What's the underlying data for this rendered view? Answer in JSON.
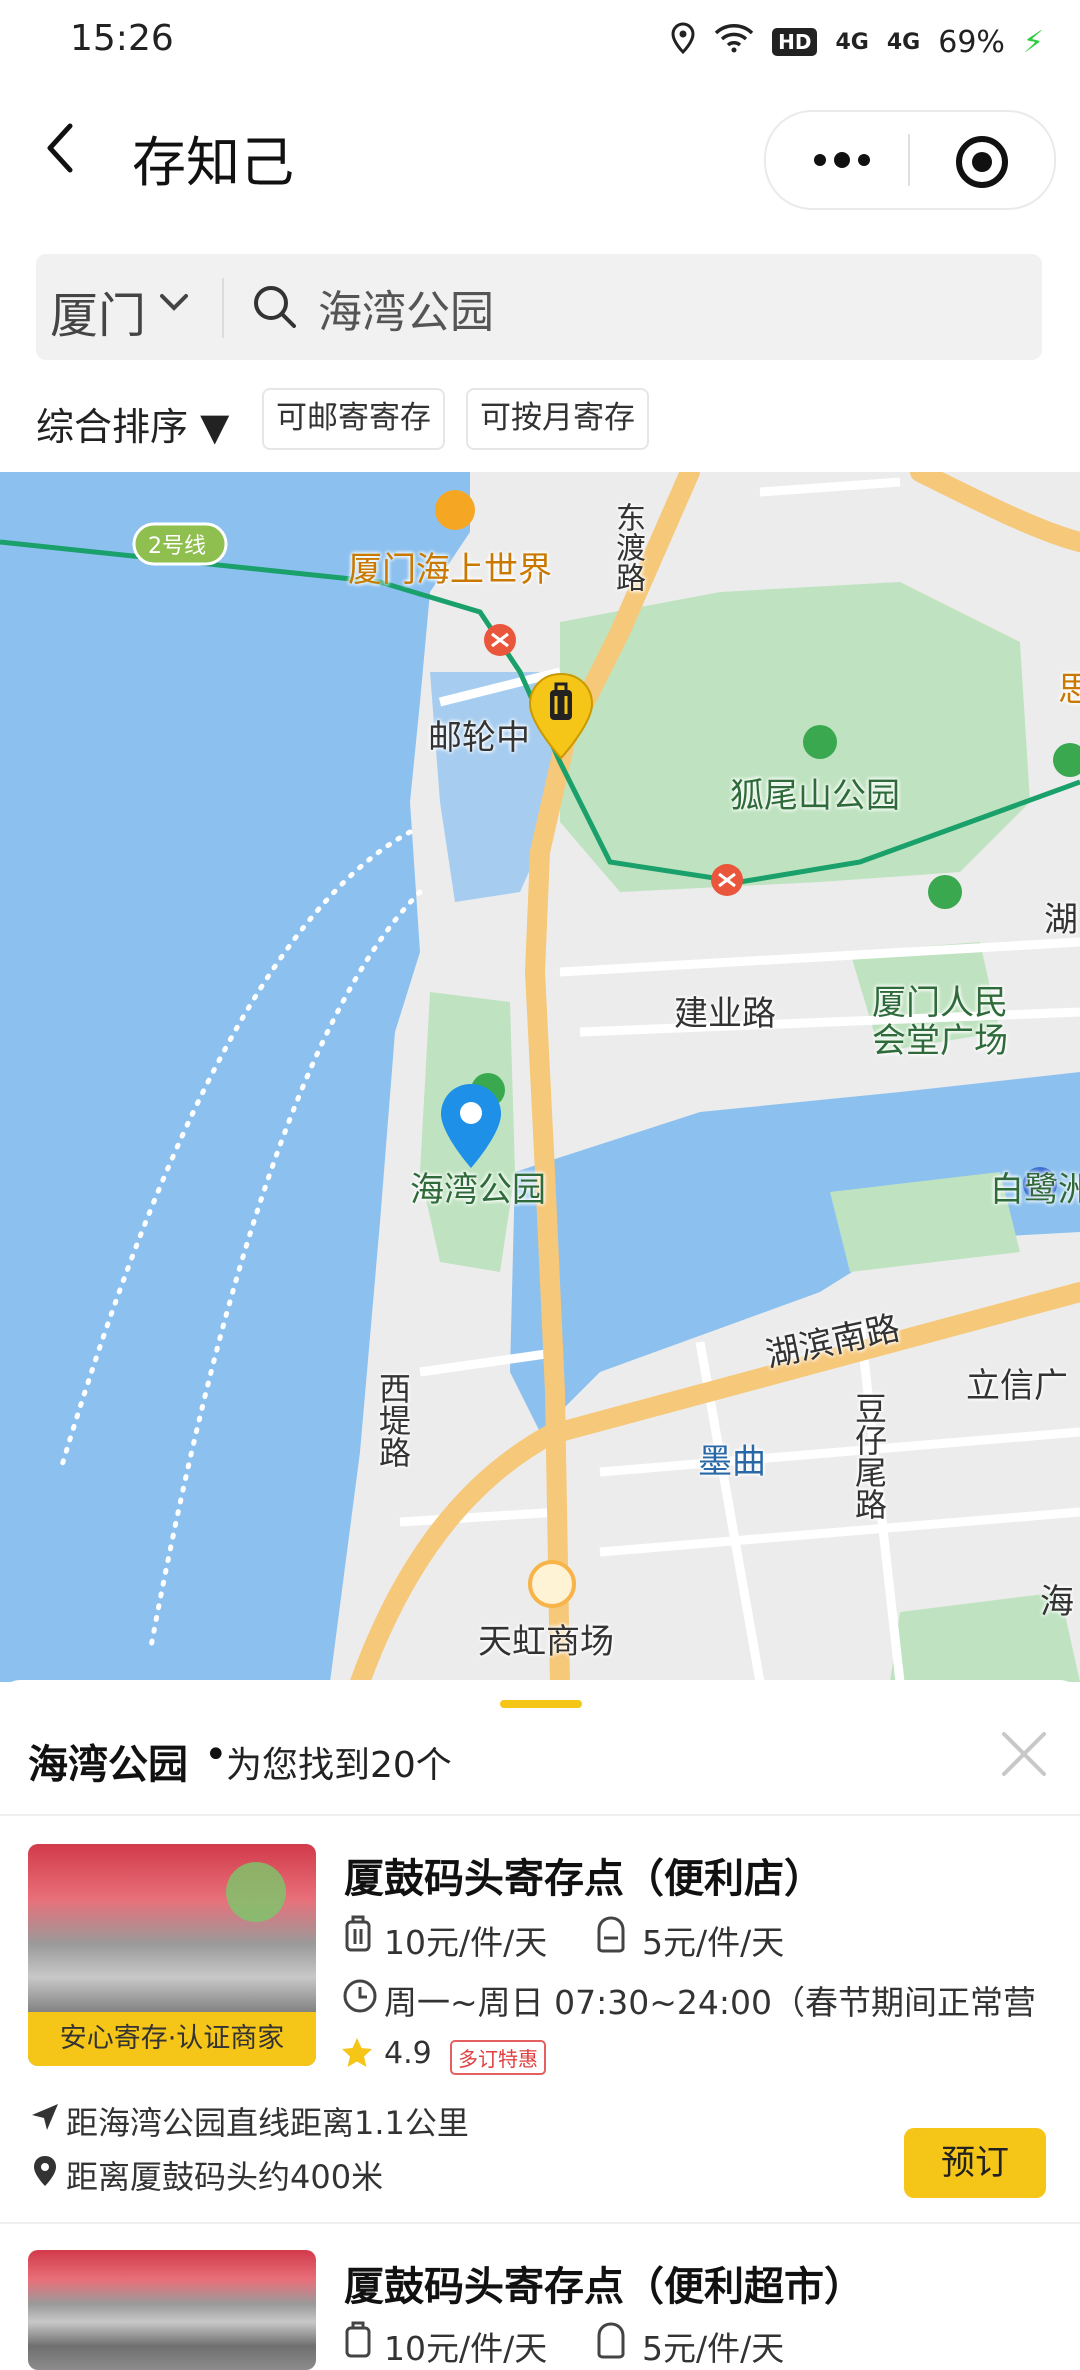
{
  "status_bar": {
    "time": "15:26",
    "battery": "69%",
    "hd": "HD",
    "network_1": "4G",
    "network_2": "4G"
  },
  "header": {
    "title": "存知己"
  },
  "search": {
    "city": "厦门",
    "query": "海湾公园"
  },
  "filters": {
    "sort": "综合排序 ▼",
    "chips": [
      "可邮寄寄存",
      "可按月寄存"
    ]
  },
  "map": {
    "labels": {
      "haishang_shijie": "厦门海上世界",
      "dongdu_road": "东渡路",
      "line2": "2号线",
      "youlun": "邮轮中",
      "huweishan": "狐尾山公园",
      "jianye_road": "建业路",
      "renmin_huitang": "厦门人民会堂广场",
      "bailu": "白鹭洲",
      "haiwan_park": "海湾公园",
      "hubin_south": "湖滨南路",
      "lixin": "立信广",
      "xidi_road": "西堤路",
      "mouqu": "墨曲",
      "douzaiwei": "豆仔尾路",
      "tianhong": "天虹商场",
      "hu_edge": "湖",
      "si_edge": "思",
      "hai_edge": "海"
    },
    "colors": {
      "water": "#8cc1ef",
      "park": "#bfe3c0",
      "road_major": "#f6c87a",
      "metro": "#1aa06a"
    }
  },
  "results": {
    "place": "海湾公园",
    "dot": "•",
    "count_text": "为您找到20个",
    "items": [
      {
        "name": "厦鼓码头寄存点（便利店）",
        "badge": "安心寄存·认证商家",
        "price_luggage": "10元/件/天",
        "price_bag": "5元/件/天",
        "hours": "周一~周日 07:30~24:00（春节期间正常营…",
        "rating": "4.9",
        "promo": "多订特惠",
        "distance_line": "距海湾公园直线距离1.1公里",
        "walk_line": "距离厦鼓码头约400米",
        "book_label": "预订"
      },
      {
        "name": "厦鼓码头寄存点（便利超市）",
        "price_luggage": "10元/件/天",
        "price_bag": "5元/件/天"
      }
    ]
  },
  "icons": [
    "back-icon",
    "more-dots-icon",
    "target-icon",
    "chevron-down-icon",
    "search-icon",
    "luggage-pin-icon",
    "location-pin-icon",
    "close-icon",
    "luggage-icon",
    "backpack-icon",
    "clock-icon",
    "star-icon",
    "navigation-arrow-icon",
    "location-icon"
  ]
}
